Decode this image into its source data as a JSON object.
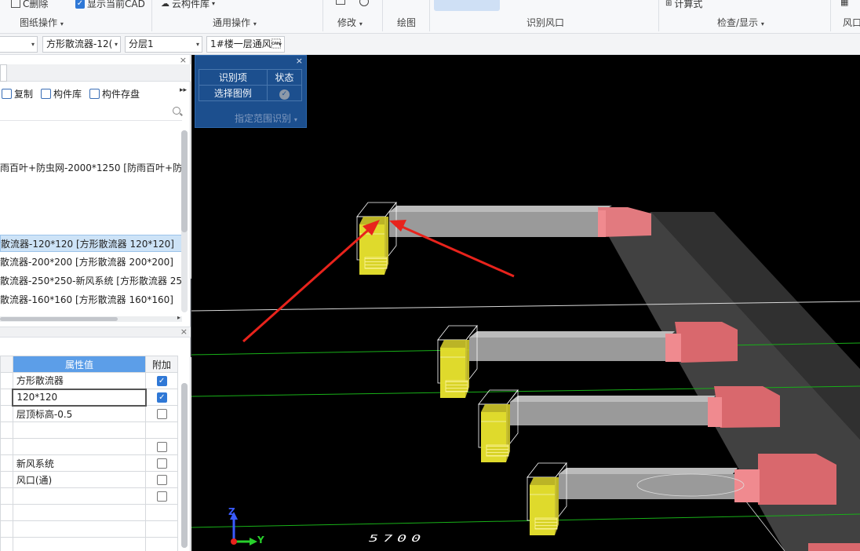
{
  "ribbon": {
    "top_items": [
      {
        "label": "C删除"
      },
      {
        "label": "显示当前CAD",
        "checked": true
      },
      {
        "label": "云构件库"
      },
      {
        "label": "计算式"
      }
    ],
    "groups": [
      {
        "label": "图纸操作"
      },
      {
        "label": "通用操作"
      },
      {
        "label": "修改"
      },
      {
        "label": "绘图"
      },
      {
        "label": "识别风口"
      },
      {
        "label": "检查/显示"
      },
      {
        "label": "风口"
      }
    ]
  },
  "selectors": [
    {
      "value": ""
    },
    {
      "value": "方形散流器-12("
    },
    {
      "value": "分层1"
    },
    {
      "value": "1#楼一层通风\u0018"
    }
  ],
  "left_panel": {
    "toolbar": [
      {
        "label": "复制",
        "icon": "copy-icon"
      },
      {
        "label": "构件库",
        "icon": "component-library-icon"
      },
      {
        "label": "构件存盘",
        "icon": "save-component-icon"
      }
    ],
    "tree": [
      {
        "label": "雨百叶+防虫网-2000*1250 [防雨百叶+防虫",
        "selected": false
      },
      {
        "label": "散流器-120*120 [方形散流器 120*120]",
        "selected": true
      },
      {
        "label": "散流器-200*200 [方形散流器 200*200]",
        "selected": false
      },
      {
        "label": "散流器-250*250-新风系统 [方形散流器 25",
        "selected": false
      },
      {
        "label": "散流器-160*160 [方形散流器 160*160]",
        "selected": false
      }
    ],
    "properties": {
      "headers": {
        "value": "属性值",
        "addon": "附加"
      },
      "rows": [
        {
          "value": "方形散流器",
          "checkbox": "checked"
        },
        {
          "value": "120*120",
          "checkbox": "checked",
          "editing": true
        },
        {
          "value": "层顶标高-0.5",
          "checkbox": "unchecked"
        },
        {
          "value": "",
          "checkbox": "none"
        },
        {
          "value": "",
          "checkbox": "unchecked"
        },
        {
          "value": "新风系统",
          "checkbox": "unchecked"
        },
        {
          "value": "风口(通)",
          "checkbox": "unchecked"
        },
        {
          "value": "",
          "checkbox": "unchecked"
        },
        {
          "value": "",
          "checkbox": "none"
        },
        {
          "value": "",
          "checkbox": "none"
        },
        {
          "value": "",
          "checkbox": "none"
        }
      ]
    }
  },
  "recognition_panel": {
    "headers": [
      "识别项",
      "状态"
    ],
    "rows": [
      {
        "item": "选择图例",
        "status": "ok"
      }
    ],
    "button": "指定范围识别"
  },
  "viewport": {
    "axis_labels": {
      "z": "Z",
      "y": "Y"
    },
    "dimension_text": "5700",
    "colors": {
      "background": "#000000",
      "duct": "#9a9a9a",
      "fitting": "#e27a7f",
      "diffuser": "#e5e02e",
      "grid_line": "#18b018",
      "annotation_arrow": "#e8231c"
    }
  }
}
